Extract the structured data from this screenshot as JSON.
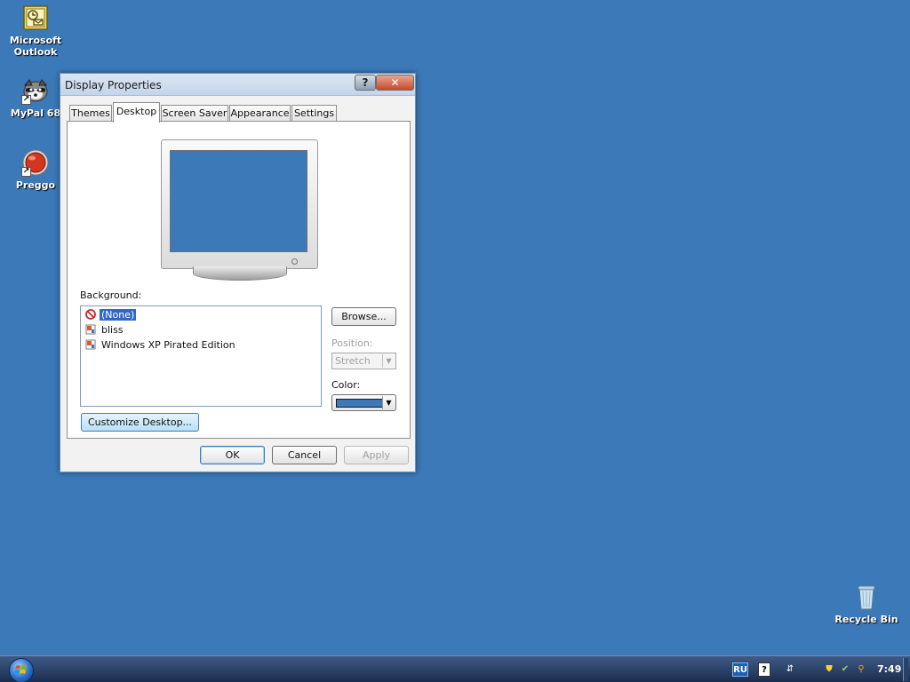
{
  "desktop": {
    "icons": [
      {
        "label_line1": "Microsoft",
        "label_line2": "Outlook"
      },
      {
        "label_line1": "MyPal 68"
      },
      {
        "label_line1": "Preggo"
      },
      {
        "label_line1": "Recycle Bin"
      }
    ]
  },
  "window": {
    "title": "Display Properties",
    "help_glyph": "?",
    "close_glyph": "✕",
    "tabs": [
      "Themes",
      "Desktop",
      "Screen Saver",
      "Appearance",
      "Settings"
    ],
    "active_tab": "Desktop",
    "background_label": "Background:",
    "background_items": [
      "(None)",
      "bliss",
      "Windows XP Pirated Edition"
    ],
    "selected_background": "(None)",
    "browse_label": "Browse...",
    "position_label": "Position:",
    "position_value": "Stretch",
    "color_label": "Color:",
    "color_value": "#3b79b8",
    "customize_label": "Customize Desktop...",
    "ok_label": "OK",
    "cancel_label": "Cancel",
    "apply_label": "Apply"
  },
  "taskbar": {
    "language": "RU",
    "clock": "7:49"
  },
  "colors": {
    "desktop_bg": "#3b79b8",
    "selection": "#3169c6"
  }
}
